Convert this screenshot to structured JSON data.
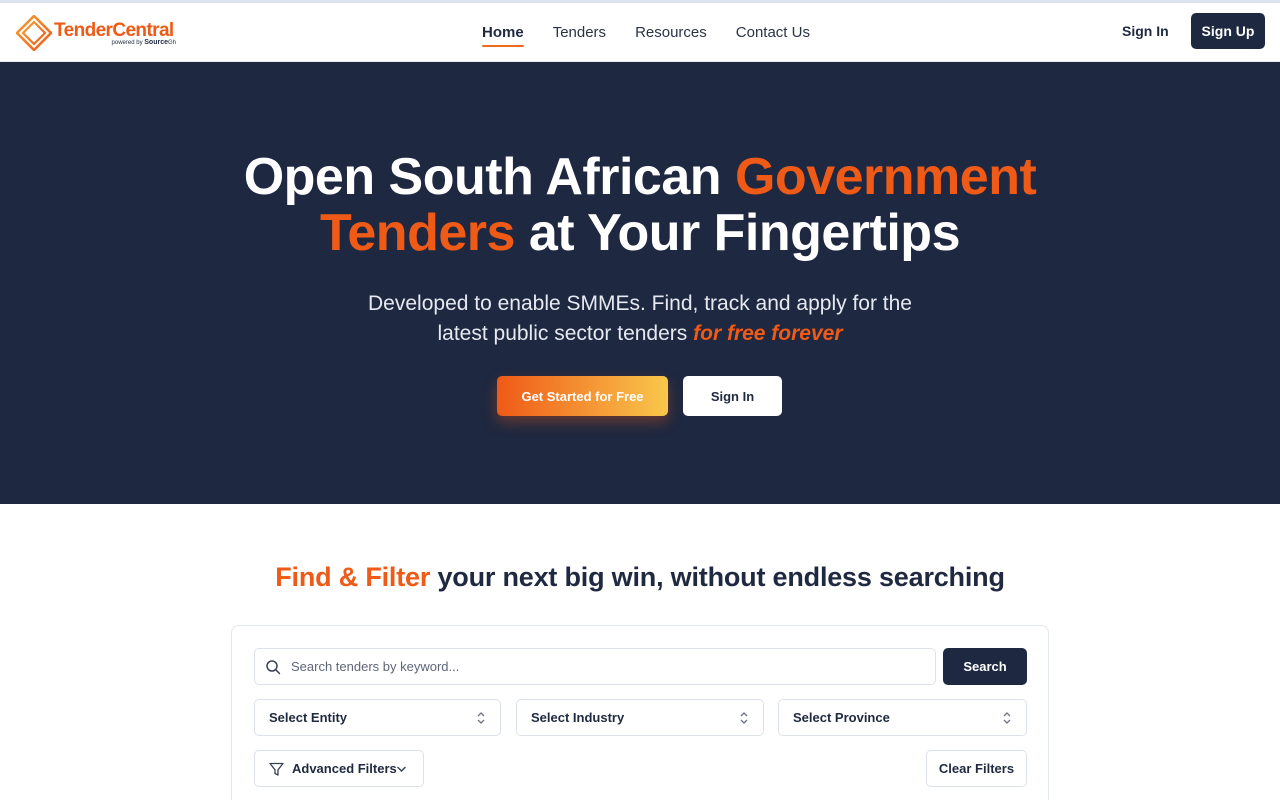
{
  "brand": {
    "name_part1": "Tender",
    "name_part2": "Central",
    "powered_by": "powered by",
    "powered_brand": "Source",
    "powered_suffix": "Gh",
    "primary_color": "#1e2840",
    "accent_color": "#ef5a17"
  },
  "nav": {
    "links": [
      {
        "label": "Home",
        "active": true
      },
      {
        "label": "Tenders",
        "active": false
      },
      {
        "label": "Resources",
        "active": false
      },
      {
        "label": "Contact Us",
        "active": false
      }
    ],
    "sign_in": "Sign In",
    "sign_up": "Sign Up"
  },
  "hero": {
    "title_part1": "Open South African ",
    "title_accent1": "Government",
    "title_accent2": "Tenders",
    "title_part2": " at Your Fingertips",
    "subtitle_line1": "Developed to enable SMMEs. Find, track and apply for the",
    "subtitle_line2": "latest public sector tenders ",
    "subtitle_accent": "for free forever",
    "cta_primary": "Get Started for Free",
    "cta_secondary": "Sign In"
  },
  "finder": {
    "title_accent": "Find & Filter",
    "title_rest": " your next big win, without endless searching",
    "search_placeholder": "Search tenders by keyword...",
    "search_value": "",
    "search_button": "Search",
    "selects": {
      "entity": "Select Entity",
      "industry": "Select Industry",
      "province": "Select Province"
    },
    "advanced_filters": "Advanced Filters",
    "clear_filters": "Clear Filters"
  },
  "icons": {
    "logo": "diamond-logo-icon",
    "search": "search-icon",
    "select_chevron": "chevron-up-down-icon",
    "filter": "filter-funnel-icon",
    "advanced_chevron": "chevron-down-icon"
  }
}
